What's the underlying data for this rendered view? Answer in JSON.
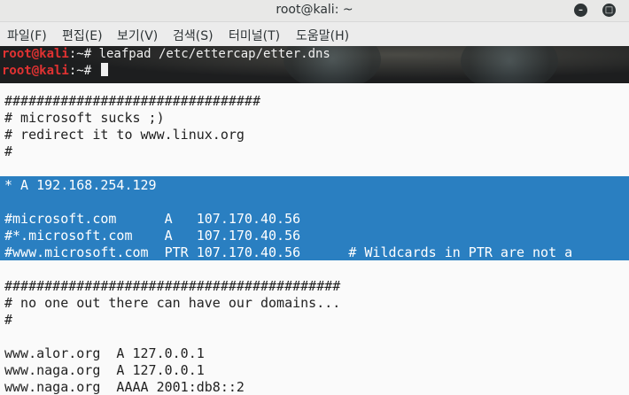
{
  "window": {
    "title": "root@kali: ~"
  },
  "menu": [
    "파일(F)",
    "편집(E)",
    "보기(V)",
    "검색(S)",
    "터미널(T)",
    "도움말(H)"
  ],
  "terminal": {
    "user": "root@kali",
    "line1_rest": ":~# leafpad /etc/ettercap/etter.dns",
    "line2_rest": ":~# "
  },
  "editor": {
    "lines": [
      "################################",
      "# microsoft sucks ;)",
      "# redirect it to www.linux.org",
      "#",
      "",
      "* A 192.168.254.129",
      "",
      "#microsoft.com      A   107.170.40.56",
      "#*.microsoft.com    A   107.170.40.56",
      "#www.microsoft.com  PTR 107.170.40.56      # Wildcards in PTR are not a",
      "",
      "##########################################",
      "# no one out there can have our domains...",
      "#",
      "",
      "www.alor.org  A 127.0.0.1",
      "www.naga.org  A 127.0.0.1",
      "www.naga.org  AAAA 2001:db8::2"
    ]
  },
  "colors": {
    "selection": "#2a7fc1",
    "prompt_user": "#e03232"
  }
}
